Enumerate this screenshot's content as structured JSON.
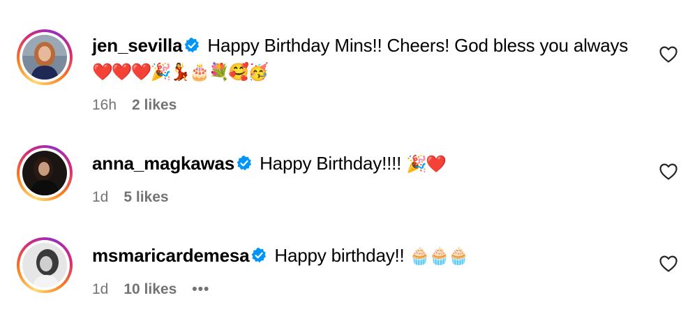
{
  "comments": [
    {
      "username": "jen_sevilla",
      "text": "Happy Birthday Mins!! Cheers! God bless you always",
      "emojis": "❤️❤️❤️🎉💃🎂💐🥰🥳",
      "time": "16h",
      "likes": "2 likes"
    },
    {
      "username": "anna_magkawas",
      "text": "Happy Birthday!!!!",
      "emojis": "🎉❤️",
      "time": "1d",
      "likes": "5 likes"
    },
    {
      "username": "msmaricardemesa",
      "text": "Happy birthday!!",
      "emojis": "🧁🧁🧁",
      "time": "1d",
      "likes": "10 likes",
      "more": "•••"
    }
  ],
  "icons": {
    "verified": "verified-badge-icon",
    "like": "heart-outline-icon",
    "more": "more-options-icon"
  },
  "colors": {
    "verified_blue": "#0095f6",
    "meta_gray": "#737373"
  }
}
